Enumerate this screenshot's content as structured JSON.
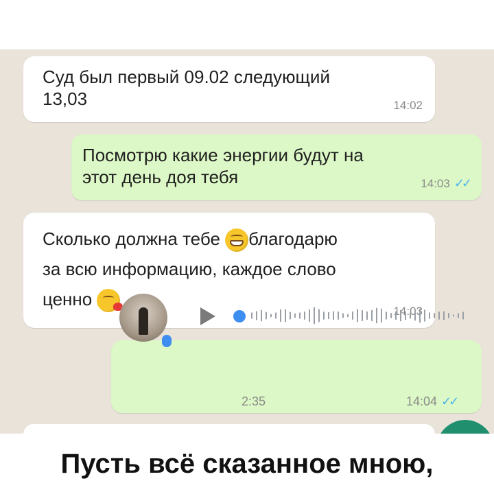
{
  "messages": [
    {
      "direction": "incoming",
      "text_lines": [
        "Суд был первый 09.02 следующий",
        "13,03"
      ],
      "time": "14:02"
    },
    {
      "direction": "outgoing",
      "text_lines": [
        "Посмотрю какие энергии будут на",
        "этот день доя тебя"
      ],
      "time": "14:03",
      "ticks": "✓✓"
    },
    {
      "direction": "incoming",
      "text_lines": [
        "Сколько должна тебе",
        "благодарю",
        "за всю информацию, каждое слово",
        "ценно"
      ],
      "emojis": [
        "grin-emoji",
        "kiss-emoji"
      ],
      "time": "14:03"
    },
    {
      "direction": "outgoing",
      "type": "voice",
      "duration": "2:35",
      "time": "14:04",
      "ticks": "✓✓"
    }
  ],
  "caption": {
    "line1": "Пусть всё сказанное мною,"
  },
  "colors": {
    "chat_bg": "#e9e3da",
    "incoming": "#ffffff",
    "outgoing": "#dcf8c6",
    "ticks": "#4fb6ec",
    "accent": "#3d8ef0",
    "fab": "#1f8f6e"
  }
}
